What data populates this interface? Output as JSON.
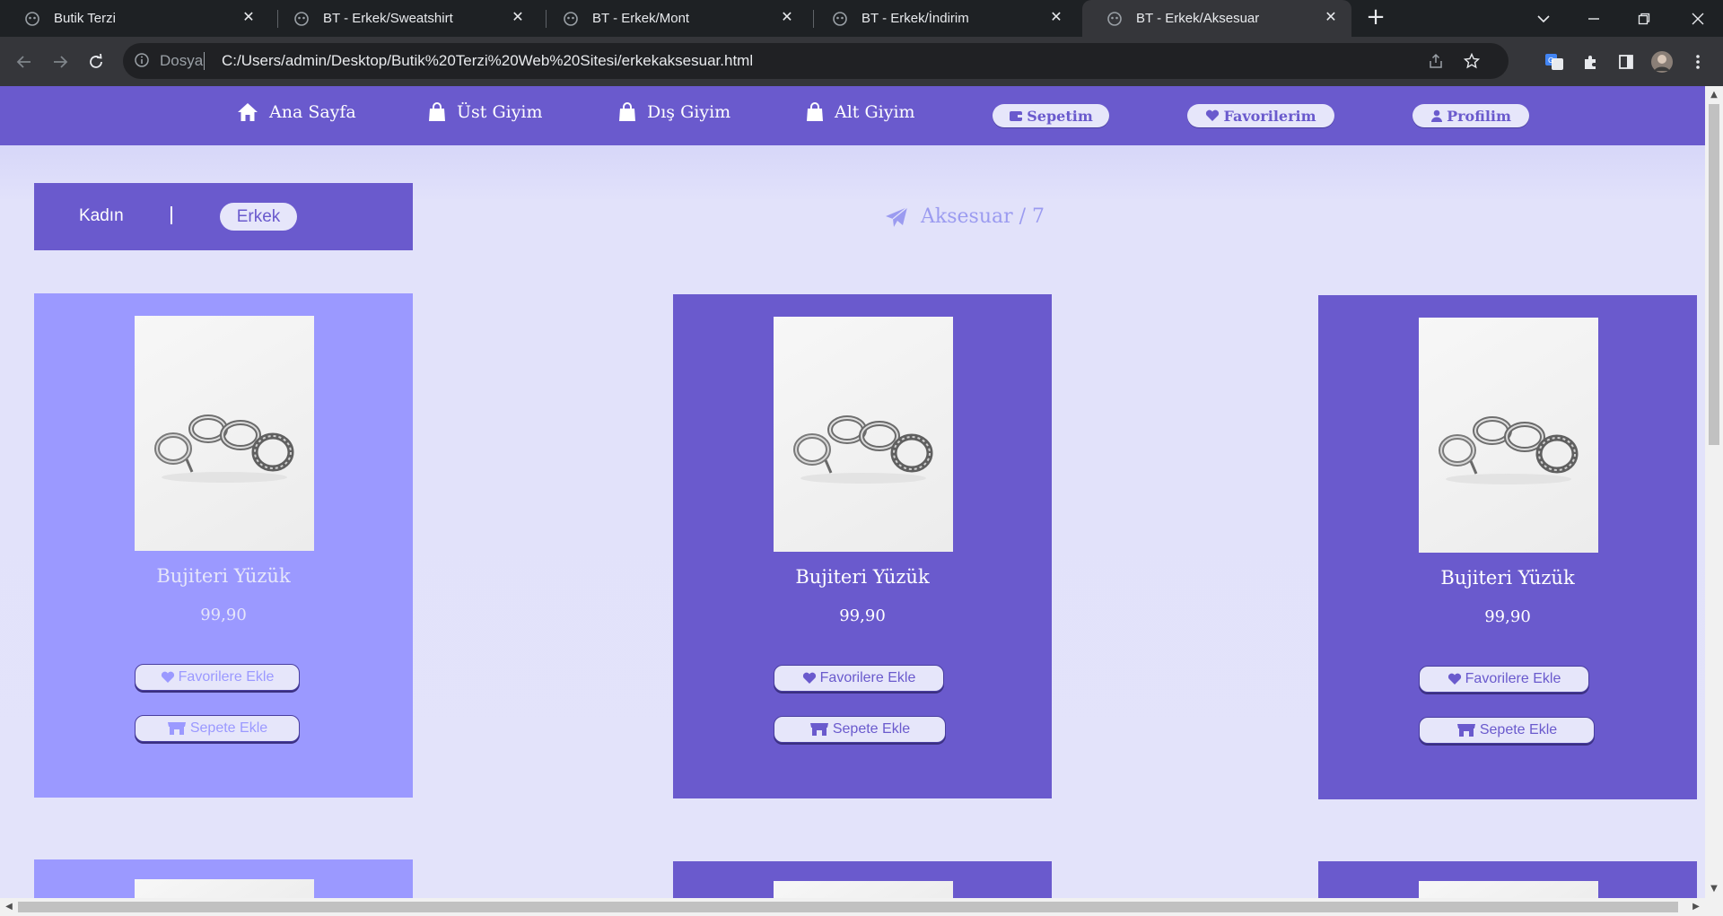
{
  "browser": {
    "tabs": [
      {
        "title": "Butik Terzi",
        "active": false
      },
      {
        "title": "BT - Erkek/Sweatshirt",
        "active": false
      },
      {
        "title": "BT - Erkek/Mont",
        "active": false
      },
      {
        "title": "BT - Erkek/İndirim",
        "active": false
      },
      {
        "title": "BT - Erkek/Aksesuar",
        "active": true
      }
    ],
    "close_glyph": "✕",
    "new_tab_glyph": "+",
    "address": {
      "scheme_label": "Dosya",
      "url": "C:/Users/admin/Desktop/Butik%20Terzi%20Web%20Sitesi/erkekaksesuar.html"
    }
  },
  "nav": {
    "links": [
      {
        "label": "Ana Sayfa",
        "icon": "home-icon"
      },
      {
        "label": "Üst Giyim",
        "icon": "shopping-bag-icon"
      },
      {
        "label": "Dış Giyim",
        "icon": "shopping-bag-icon"
      },
      {
        "label": "Alt Giyim",
        "icon": "shopping-bag-icon"
      }
    ],
    "pills": [
      {
        "label": "Sepetim",
        "icon": "wallet-icon"
      },
      {
        "label": "Favorilerim",
        "icon": "heart-icon"
      },
      {
        "label": "Profilim",
        "icon": "user-icon"
      }
    ]
  },
  "gender": {
    "kadin": "Kadın",
    "erkek": "Erkek",
    "selected": "Erkek"
  },
  "category": {
    "label": "Aksesuar / 7",
    "icon": "paper-plane-icon"
  },
  "products": [
    {
      "name": "Bujiteri Yüzük",
      "price": "99,90",
      "fav_label": "Favorilere Ekle",
      "cart_label": "Sepete Ekle",
      "highlighted": true
    },
    {
      "name": "Bujiteri Yüzük",
      "price": "99,90",
      "fav_label": "Favorilere Ekle",
      "cart_label": "Sepete Ekle",
      "highlighted": false
    },
    {
      "name": "Bujiteri Yüzük",
      "price": "99,90",
      "fav_label": "Favorilere Ekle",
      "cart_label": "Sepete Ekle",
      "highlighted": false
    }
  ],
  "colors": {
    "brand": "#6a5acd",
    "brand_light": "#9b99ff",
    "pill_bg": "#e6e6fa",
    "page_bg": "#e3e3fa"
  }
}
